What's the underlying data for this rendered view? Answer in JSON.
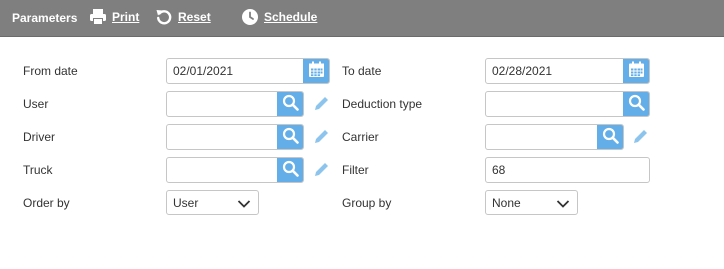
{
  "toolbar": {
    "title": "Parameters",
    "print_label": "Print",
    "reset_label": "Reset",
    "schedule_label": "Schedule"
  },
  "form": {
    "from_date": {
      "label": "From date",
      "value": "02/01/2021"
    },
    "to_date": {
      "label": "To date",
      "value": "02/28/2021"
    },
    "user": {
      "label": "User",
      "value": ""
    },
    "deduction_type": {
      "label": "Deduction type",
      "value": ""
    },
    "driver": {
      "label": "Driver",
      "value": ""
    },
    "carrier": {
      "label": "Carrier",
      "value": ""
    },
    "truck": {
      "label": "Truck",
      "value": ""
    },
    "filter": {
      "label": "Filter",
      "value": "68"
    },
    "order_by": {
      "label": "Order by",
      "value": "User"
    },
    "group_by": {
      "label": "Group by",
      "value": "None"
    }
  },
  "colors": {
    "toolbar_bg": "#7f7f7f",
    "accent": "#63aee8",
    "pencil": "#8cc4ee"
  },
  "icons": [
    "printer-icon",
    "reset-icon",
    "clock-icon",
    "calendar-icon",
    "search-icon",
    "pencil-icon",
    "chevron-down-icon"
  ]
}
